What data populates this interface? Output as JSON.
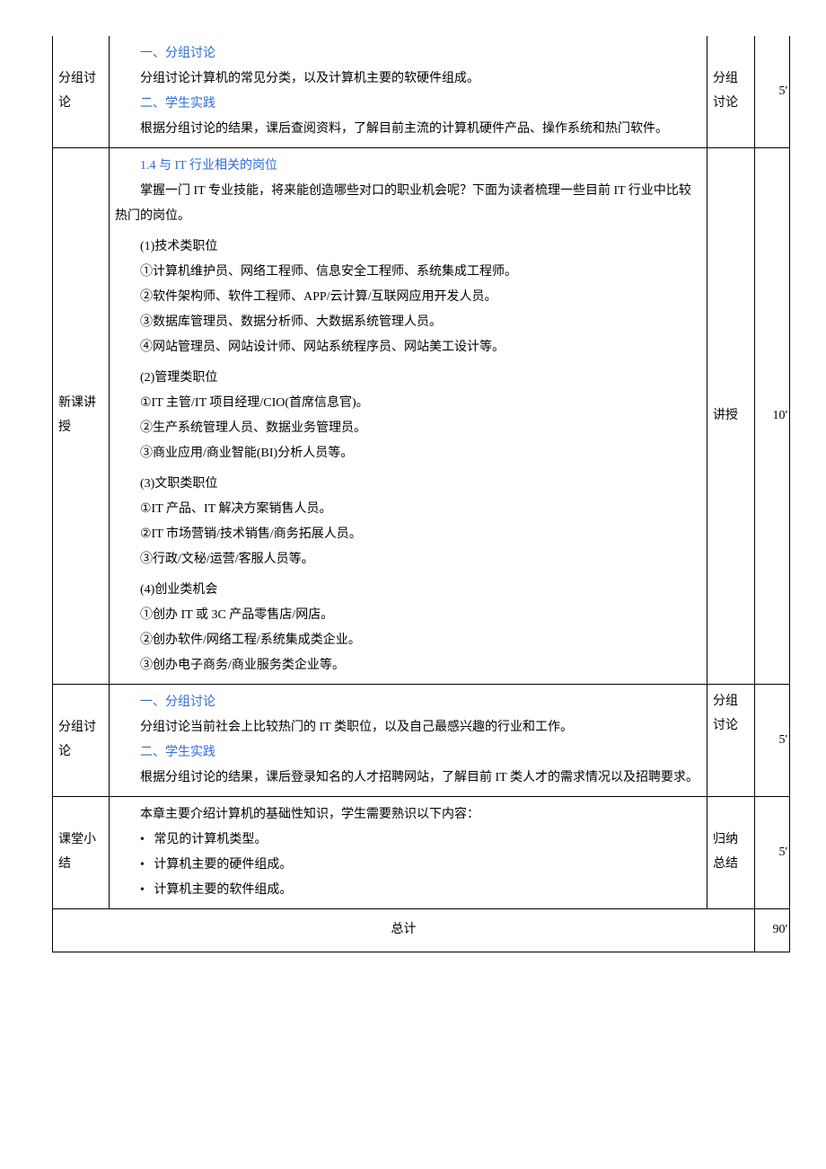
{
  "rows": [
    {
      "label": "分组讨论",
      "method": "分组讨论",
      "time": "5'",
      "content": {
        "h1": "一、分组讨论",
        "p1": "分组讨论计算机的常见分类，以及计算机主要的软硬件组成。",
        "h2": "二、学生实践",
        "p2": "根据分组讨论的结果，课后查阅资料，了解目前主流的计算机硬件产品、操作系统和热门软件。"
      }
    },
    {
      "label": "新课讲授",
      "method": "讲授",
      "time": "10'",
      "content": {
        "title": "1.4 与 IT 行业相关的岗位",
        "intro": "掌握一门 IT 专业技能，将来能创造哪些对口的职业机会呢？下面为读者梳理一些目前 IT 行业中比较热门的岗位。",
        "g1_h": "(1)技术类职位",
        "g1_l1": "①计算机维护员、网络工程师、信息安全工程师、系统集成工程师。",
        "g1_l2": "②软件架构师、软件工程师、APP/云计算/互联网应用开发人员。",
        "g1_l3": "③数据库管理员、数据分析师、大数据系统管理人员。",
        "g1_l4": "④网站管理员、网站设计师、网站系统程序员、网站美工设计等。",
        "g2_h": "(2)管理类职位",
        "g2_l1": "①IT 主管/IT 项目经理/CIO(首席信息官)。",
        "g2_l2": "②生产系统管理人员、数据业务管理员。",
        "g2_l3": "③商业应用/商业智能(BI)分析人员等。",
        "g3_h": "(3)文职类职位",
        "g3_l1": "①IT 产品、IT 解决方案销售人员。",
        "g3_l2": "②IT 市场营销/技术销售/商务拓展人员。",
        "g3_l3": "③行政/文秘/运营/客服人员等。",
        "g4_h": "(4)创业类机会",
        "g4_l1": "①创办 IT 或 3C 产品零售店/网店。",
        "g4_l2": "②创办软件/网络工程/系统集成类企业。",
        "g4_l3": "③创办电子商务/商业服务类企业等。"
      }
    },
    {
      "label": "分组讨论",
      "method": "分组讨论",
      "time": "5'",
      "content": {
        "h1": "一、分组讨论",
        "p1": "分组讨论当前社会上比较热门的 IT 类职位，以及自己最感兴趣的行业和工作。",
        "h2": "二、学生实践",
        "p2": "根据分组讨论的结果，课后登录知名的人才招聘网站，了解目前 IT 类人才的需求情况以及招聘要求。"
      }
    },
    {
      "label": "课堂小结",
      "method": "归纳总结",
      "time": "5'",
      "content": {
        "intro": "本章主要介绍计算机的基础性知识，学生需要熟识以下内容：",
        "b1": "常见的计算机类型。",
        "b2": "计算机主要的硬件组成。",
        "b3": "计算机主要的软件组成。"
      }
    }
  ],
  "total": {
    "label": "总计",
    "value": "90'"
  }
}
